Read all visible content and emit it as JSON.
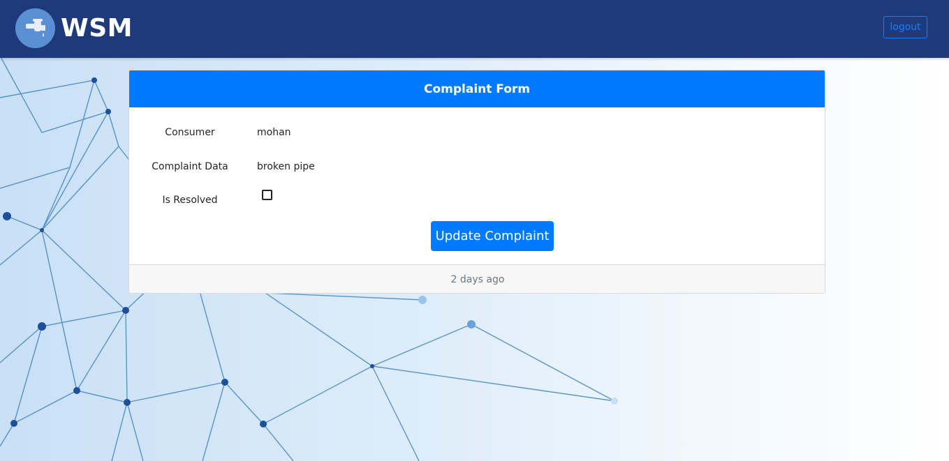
{
  "header": {
    "brand": "WSM",
    "logout_label": "logout"
  },
  "form": {
    "title": "Complaint Form",
    "fields": [
      {
        "label": "Consumer",
        "value": "mohan"
      },
      {
        "label": "Complaint Data",
        "value": "broken pipe"
      },
      {
        "label": "Is Resolved",
        "checked": false
      }
    ],
    "submit_label": "Update Complaint",
    "footer": "2 days ago"
  },
  "colors": {
    "navbar": "#1f3a7a",
    "primary": "#007bff",
    "logo": "#5b8fd4"
  }
}
